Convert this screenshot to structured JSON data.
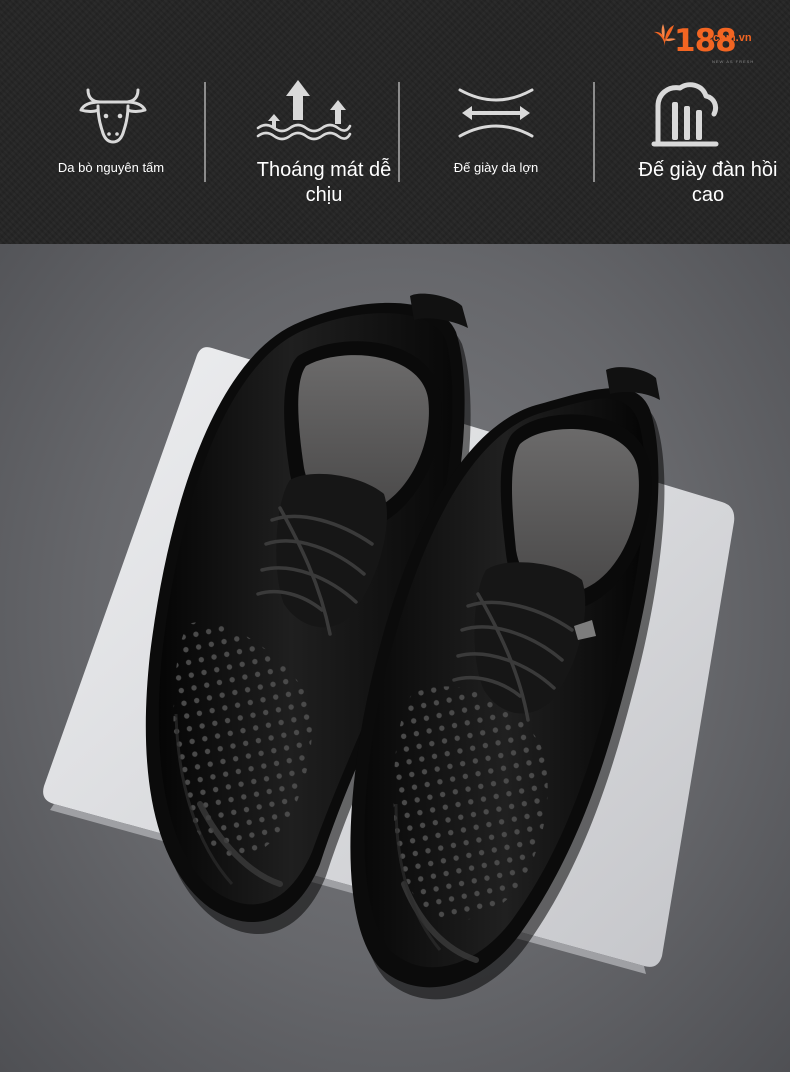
{
  "brand": {
    "logo_number": "188",
    "logo_domain": ".com.vn",
    "logo_tagline": "NEW AS FRESH"
  },
  "features": [
    {
      "icon": "cow-head-icon",
      "label": "Da bò nguyên tấm"
    },
    {
      "icon": "breathable-arrows-icon",
      "label": "Thoáng mát dễ chịu"
    },
    {
      "icon": "flexible-sole-icon",
      "label": "Đế giày da lợn"
    },
    {
      "icon": "elastic-sole-icon",
      "label": "Đế giày đàn hồi cao"
    }
  ],
  "colors": {
    "banner_bg": "#242424",
    "brand_orange": "#f26522",
    "photo_bg": "#6e6f73",
    "shoe_leather": "#121212"
  }
}
